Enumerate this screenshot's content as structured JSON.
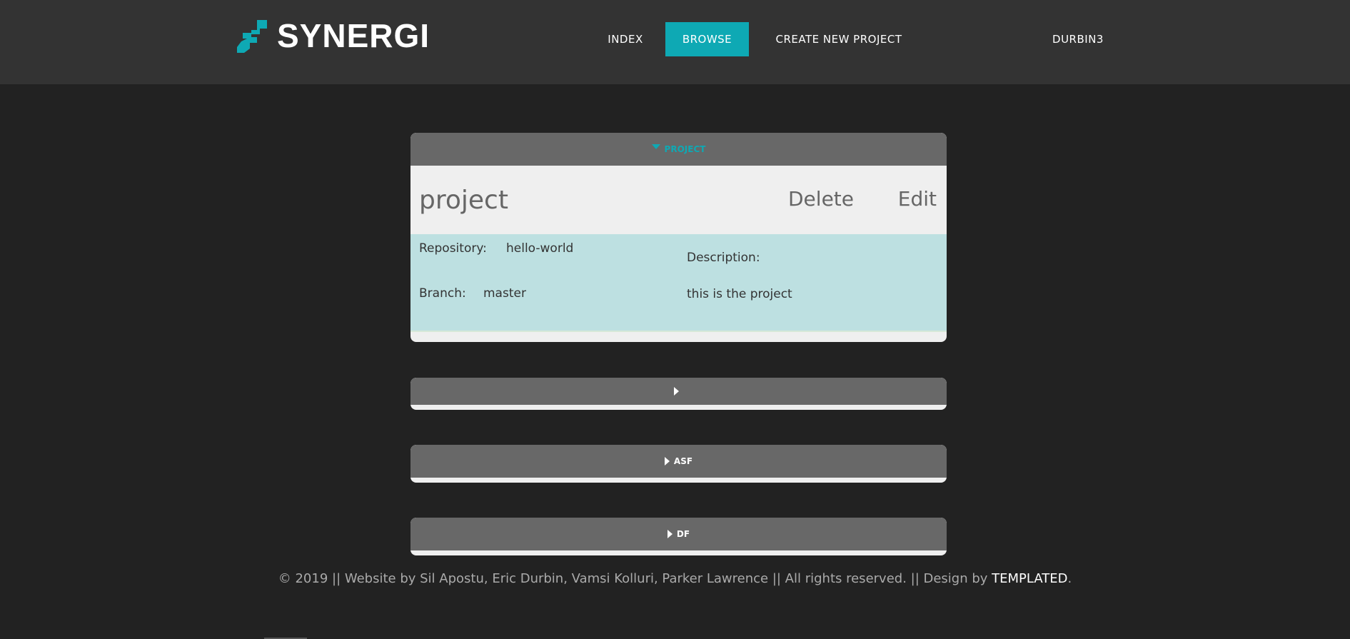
{
  "header": {
    "logo_text": "SYNERGI",
    "nav": {
      "index": "INDEX",
      "browse": "BROWSE",
      "create": "CREATE NEW PROJECT",
      "user": "DURBIN3"
    }
  },
  "panels": {
    "open": {
      "header_label": "PROJECT",
      "title": "project",
      "delete_label": "Delete",
      "edit_label": "Edit",
      "repository_label": "Repository:",
      "repository_value": "hello-world",
      "branch_label": "Branch:",
      "branch_value": "master",
      "description_label": "Description:",
      "description_value": "this is the project"
    },
    "closed": [
      {
        "label": ""
      },
      {
        "label": "ASF"
      },
      {
        "label": "DF"
      }
    ]
  },
  "footer": {
    "text": "© 2019 || Website by Sil Apostu, Eric Durbin, Vamsi Kolluri, Parker Lawrence || All rights reserved. || Design by ",
    "brand": "TEMPLATED",
    "end": "."
  },
  "colors": {
    "accent": "#0ea9b4",
    "header_bg": "#333333",
    "page_bg": "#222222",
    "panel_head": "#686868",
    "details_bg": "#bde0e1"
  },
  "icons": {
    "logo": "synergi-logo-icon",
    "expanded": "caret-down-icon",
    "collapsed": "caret-right-icon"
  }
}
